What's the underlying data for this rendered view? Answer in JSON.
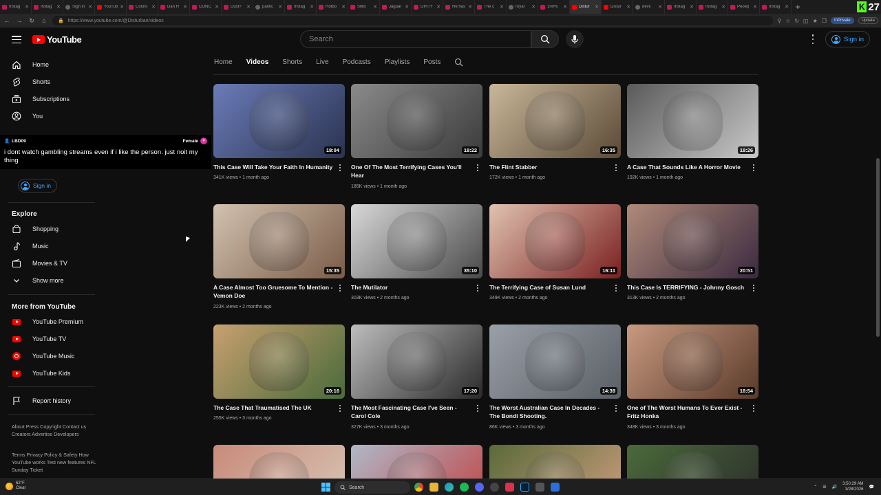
{
  "browser": {
    "tabs": [
      {
        "label": "Instag",
        "fav": "pink"
      },
      {
        "label": "Instag",
        "fav": "pink"
      },
      {
        "label": "Sign in",
        "fav": "gray"
      },
      {
        "label": "YouTub",
        "fav": "yt"
      },
      {
        "label": "Coloni",
        "fav": "pink"
      },
      {
        "label": "Dan H",
        "fav": "pink"
      },
      {
        "label": "CONC",
        "fav": "pink"
      },
      {
        "label": "Dust?",
        "fav": "pink"
      },
      {
        "label": "pantic",
        "fav": "gray"
      },
      {
        "label": "Instag",
        "fav": "pink"
      },
      {
        "label": "Hotbo",
        "fav": "pink"
      },
      {
        "label": "Stills",
        "fav": "pink"
      },
      {
        "label": "Jaguar",
        "fav": "pink"
      },
      {
        "label": "DIRTY",
        "fav": "pink"
      },
      {
        "label": "He has",
        "fav": "pink"
      },
      {
        "label": "The c",
        "fav": "pink"
      },
      {
        "label": "royal",
        "fav": "gray"
      },
      {
        "label": "100%",
        "fav": "pink"
      },
      {
        "label": "Distur",
        "fav": "yt",
        "active": true
      },
      {
        "label": "Distur",
        "fav": "yt"
      },
      {
        "label": "devil",
        "fav": "gray"
      },
      {
        "label": "Instag",
        "fav": "pink"
      },
      {
        "label": "Instag",
        "fav": "pink"
      },
      {
        "label": "Peoep",
        "fav": "pink"
      },
      {
        "label": "Instag",
        "fav": "pink"
      }
    ],
    "url": "https://www.youtube.com/@Disturban/videos",
    "inprivate_label": "InPrivate",
    "update_label": "Update",
    "kick_count": "27"
  },
  "header": {
    "logo_text": "YouTube",
    "search_placeholder": "Search",
    "signin_label": "Sign in"
  },
  "sidebar": {
    "main": [
      {
        "label": "Home",
        "icon": "home-icon"
      },
      {
        "label": "Shorts",
        "icon": "shorts-icon"
      },
      {
        "label": "Subscriptions",
        "icon": "subscriptions-icon"
      },
      {
        "label": "You",
        "icon": "you-icon"
      }
    ],
    "signin_label": "Sign in",
    "explore_title": "Explore",
    "explore": [
      {
        "label": "Shopping",
        "icon": "shopping-icon"
      },
      {
        "label": "Music",
        "icon": "music-icon"
      },
      {
        "label": "Movies & TV",
        "icon": "movies-icon"
      },
      {
        "label": "Show more",
        "icon": "chevron-down-icon"
      }
    ],
    "more_title": "More from YouTube",
    "more": [
      {
        "label": "YouTube Premium"
      },
      {
        "label": "YouTube TV"
      },
      {
        "label": "YouTube Music"
      },
      {
        "label": "YouTube Kids"
      }
    ],
    "report_label": "Report history",
    "footer1": "About  Press  Copyright  Contact us  Creators  Advertise  Developers",
    "footer2": "Terms  Privacy  Policy & Safety  How YouTube works  Test new features  NFL Sunday Ticket"
  },
  "chat": {
    "username": "LBD09",
    "badge": "Female",
    "message": "i dont watch gambling streams even if i like the person. just noit my thing"
  },
  "channel_tabs": [
    "Home",
    "Videos",
    "Shorts",
    "Live",
    "Podcasts",
    "Playlists",
    "Posts"
  ],
  "videos": [
    {
      "title": "This Case Will Take Your Faith In Humanity",
      "views": "341K views",
      "age": "1 month ago",
      "duration": "18:04",
      "colors": [
        "#6a7bb8",
        "#2b3350"
      ]
    },
    {
      "title": "One Of The Most Terrifying Cases You'll Hear",
      "views": "185K views",
      "age": "1 month ago",
      "duration": "18:22",
      "colors": [
        "#8a8a8a",
        "#3b3b3b"
      ]
    },
    {
      "title": "The Flint Stabber",
      "views": "172K views",
      "age": "1 month ago",
      "duration": "16:35",
      "colors": [
        "#c9b79a",
        "#5a4a36"
      ]
    },
    {
      "title": "A Case That Sounds Like A Horror Movie",
      "views": "192K views",
      "age": "1 month ago",
      "duration": "18:26",
      "colors": [
        "#5a5a5a",
        "#c8c8c8"
      ]
    },
    {
      "title": "A Case Almost Too Gruesome To Mention - Vemon Doe",
      "views": "223K views",
      "age": "2 months ago",
      "duration": "15:35",
      "colors": [
        "#d2c2b0",
        "#7a5c48"
      ]
    },
    {
      "title": "The Mutilator",
      "views": "303K views",
      "age": "2 months ago",
      "duration": "35:10",
      "colors": [
        "#d8d8d8",
        "#4a4a4a"
      ]
    },
    {
      "title": "The Terrifying Case of Susan Lund",
      "views": "349K views",
      "age": "2 months ago",
      "duration": "16:11",
      "colors": [
        "#e0c2b0",
        "#7a2020"
      ]
    },
    {
      "title": "This Case Is TERRIFYING - Johnny Gosch",
      "views": "313K views",
      "age": "2 months ago",
      "duration": "20:51",
      "colors": [
        "#b08a78",
        "#3a2a40"
      ]
    },
    {
      "title": "The Case That Traumatised The UK",
      "views": "255K views",
      "age": "3 months ago",
      "duration": "20:16",
      "colors": [
        "#c8a070",
        "#4a6a3a"
      ]
    },
    {
      "title": "The Most Fascinating Case I've Seen - Carol Cole",
      "views": "327K views",
      "age": "3 months ago",
      "duration": "17:20",
      "colors": [
        "#bdbdbd",
        "#2a2a2a"
      ]
    },
    {
      "title": "The Worst Australian Case In Decades - The Bondi Shooting.",
      "views": "86K views",
      "age": "3 months ago",
      "duration": "14:39",
      "colors": [
        "#9aa0a8",
        "#5a5f66"
      ]
    },
    {
      "title": "One of The Worst Humans To Ever Exist - Fritz Honka",
      "views": "348K views",
      "age": "3 months ago",
      "duration": "18:54",
      "colors": [
        "#c89a80",
        "#5a3a2a"
      ]
    },
    {
      "title": "",
      "views": "",
      "age": "",
      "duration": "",
      "colors": [
        "#c88a7a",
        "#d8c8b8"
      ]
    },
    {
      "title": "",
      "views": "",
      "age": "",
      "duration": "",
      "colors": [
        "#b0b8c8",
        "#c04040"
      ]
    },
    {
      "title": "",
      "views": "",
      "age": "",
      "duration": "",
      "colors": [
        "#5a6a3a",
        "#d0a080"
      ]
    },
    {
      "title": "",
      "views": "",
      "age": "",
      "duration": "",
      "colors": [
        "#4a6a3a",
        "#2a2a2a"
      ]
    }
  ],
  "taskbar": {
    "temp": "62°F",
    "condition": "Clear",
    "search_label": "Search",
    "time": "3:50:29 AM",
    "date": "3/28/2026"
  }
}
